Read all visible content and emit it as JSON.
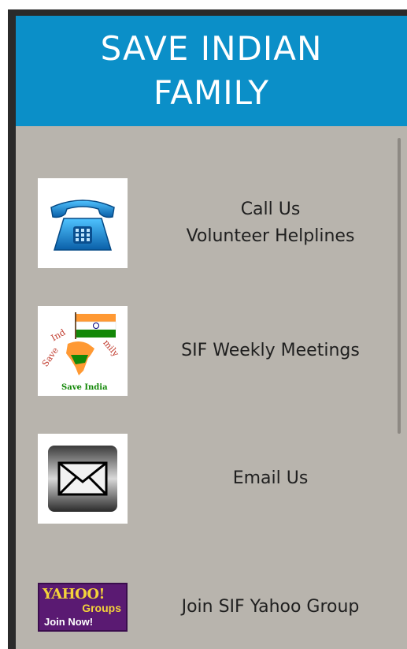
{
  "header": {
    "title": "SAVE INDIAN FAMILY"
  },
  "menu": {
    "items": [
      {
        "icon": "telephone-icon",
        "label_line1": "Call Us",
        "label_line2": "Volunteer Helplines"
      },
      {
        "icon": "sif-flag-logo",
        "label": "SIF Weekly Meetings",
        "logo_text_arc": "Save Indian Family",
        "logo_text_bottom": "Save India"
      },
      {
        "icon": "envelope-icon",
        "label": "Email Us"
      },
      {
        "icon": "yahoo-groups-badge",
        "label": "Join SIF Yahoo Group",
        "badge_brand": "YAHOO!",
        "badge_product": "Groups",
        "badge_cta": "Join Now!"
      }
    ]
  },
  "colors": {
    "header_bg": "#0b8fc8",
    "content_bg": "#b8b4ad",
    "yahoo_purple": "#5a1a72",
    "yahoo_yellow": "#f4d33a"
  }
}
